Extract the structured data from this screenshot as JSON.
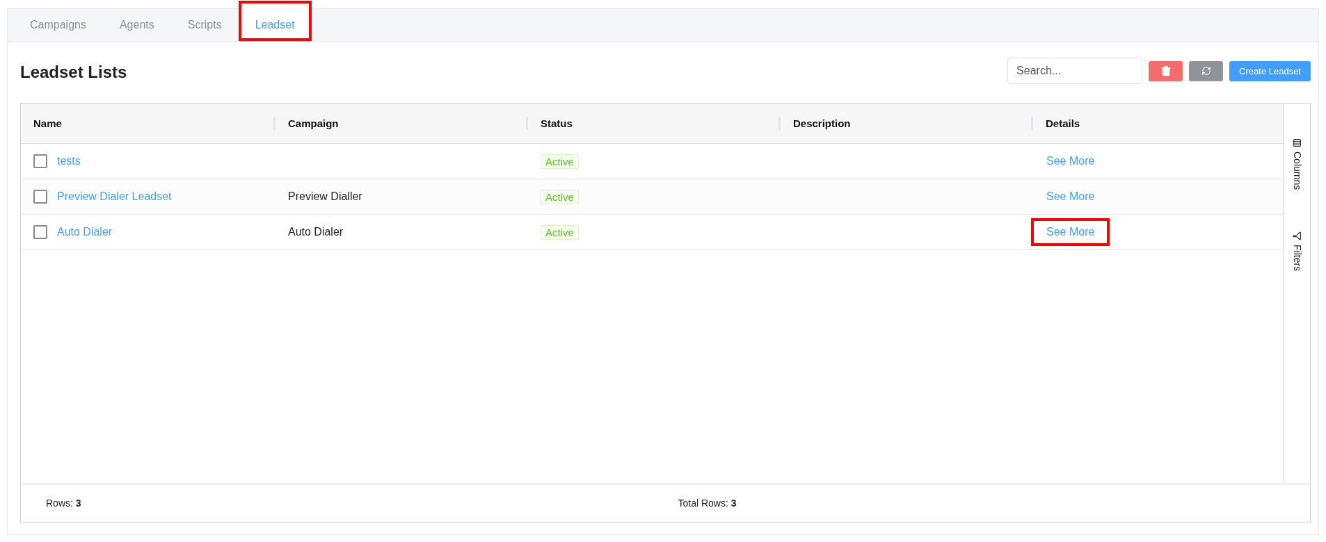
{
  "tabs": [
    {
      "label": "Campaigns",
      "selected": false,
      "highlighted": false
    },
    {
      "label": "Agents",
      "selected": false,
      "highlighted": false
    },
    {
      "label": "Scripts",
      "selected": false,
      "highlighted": false
    },
    {
      "label": "Leadset",
      "selected": true,
      "highlighted": true
    }
  ],
  "page": {
    "title": "Leadset Lists",
    "search": {
      "placeholder": "Search..."
    },
    "create_button": "Create Leadset"
  },
  "table": {
    "columns": [
      "Name",
      "Campaign",
      "Status",
      "Description",
      "Details"
    ],
    "rows": [
      {
        "name": "tests",
        "checked": false,
        "campaign": "",
        "status": "Active",
        "description": "",
        "details": "See More",
        "details_highlighted": false
      },
      {
        "name": "Preview Dialer Leadset",
        "checked": false,
        "campaign": "Preview Dialler",
        "status": "Active",
        "description": "",
        "details": "See More",
        "details_highlighted": false
      },
      {
        "name": "Auto Dialer",
        "checked": false,
        "campaign": "Auto Dialer",
        "status": "Active",
        "description": "",
        "details": "See More",
        "details_highlighted": true
      }
    ],
    "side_panel": [
      "Columns",
      "Filters"
    ],
    "footer": {
      "rows": "Rows: **3**",
      "total_rows": "Total Rows: **3**"
    }
  }
}
